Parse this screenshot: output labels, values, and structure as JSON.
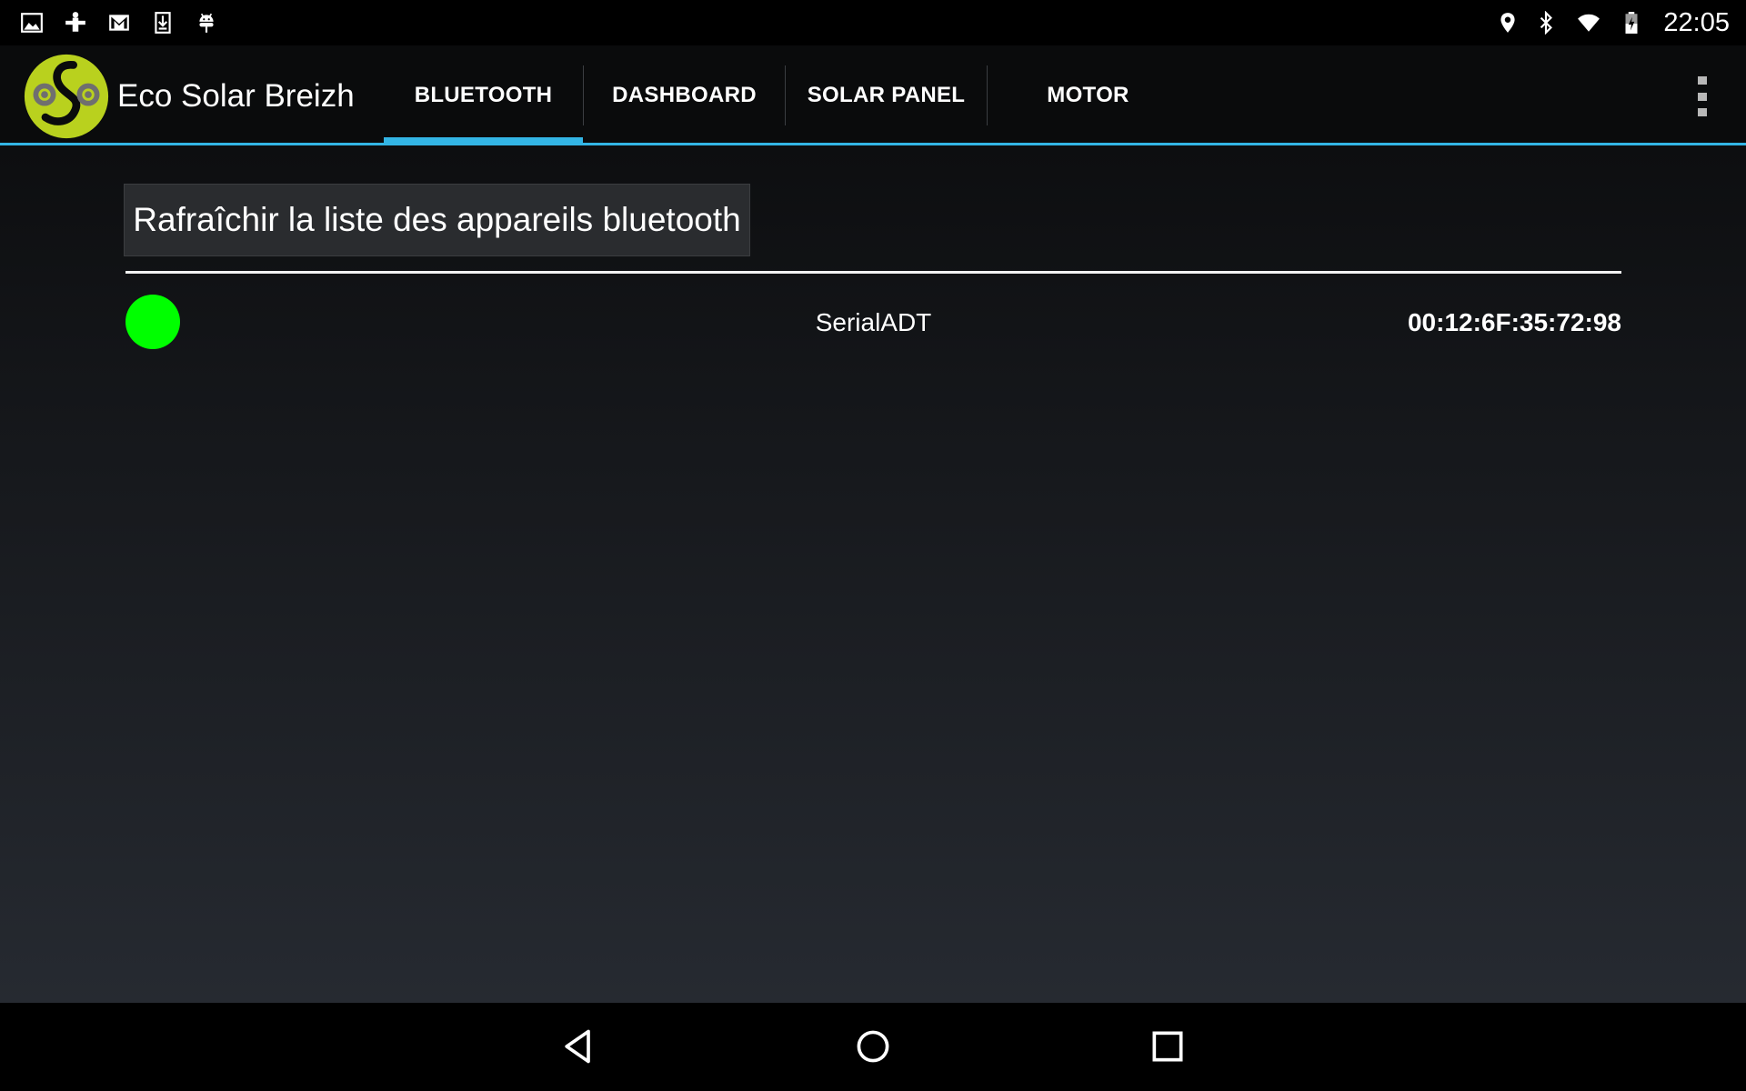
{
  "status_bar": {
    "left_icons": [
      "image-icon",
      "media-icon",
      "gmail-icon",
      "download-icon",
      "android-icon"
    ],
    "right_icons": [
      "location-icon",
      "bluetooth-icon",
      "wifi-icon",
      "battery-charging-icon"
    ],
    "time": "22:05"
  },
  "app": {
    "title": "Eco Solar Breizh",
    "logo_color": "#b9d11e"
  },
  "tabs": [
    {
      "label": "BLUETOOTH",
      "active": true
    },
    {
      "label": "DASHBOARD",
      "active": false
    },
    {
      "label": "SOLAR PANEL",
      "active": false
    },
    {
      "label": "MOTOR",
      "active": false
    }
  ],
  "accent_color": "#33b5e5",
  "main": {
    "refresh_button_label": "Rafraîchir la liste des appareils bluetooth",
    "devices": [
      {
        "name": "SerialADT",
        "mac": "00:12:6F:35:72:98",
        "status_color": "#00ff00"
      }
    ]
  },
  "nav_bar": {
    "buttons": [
      "back-icon",
      "home-icon",
      "recents-icon"
    ]
  }
}
